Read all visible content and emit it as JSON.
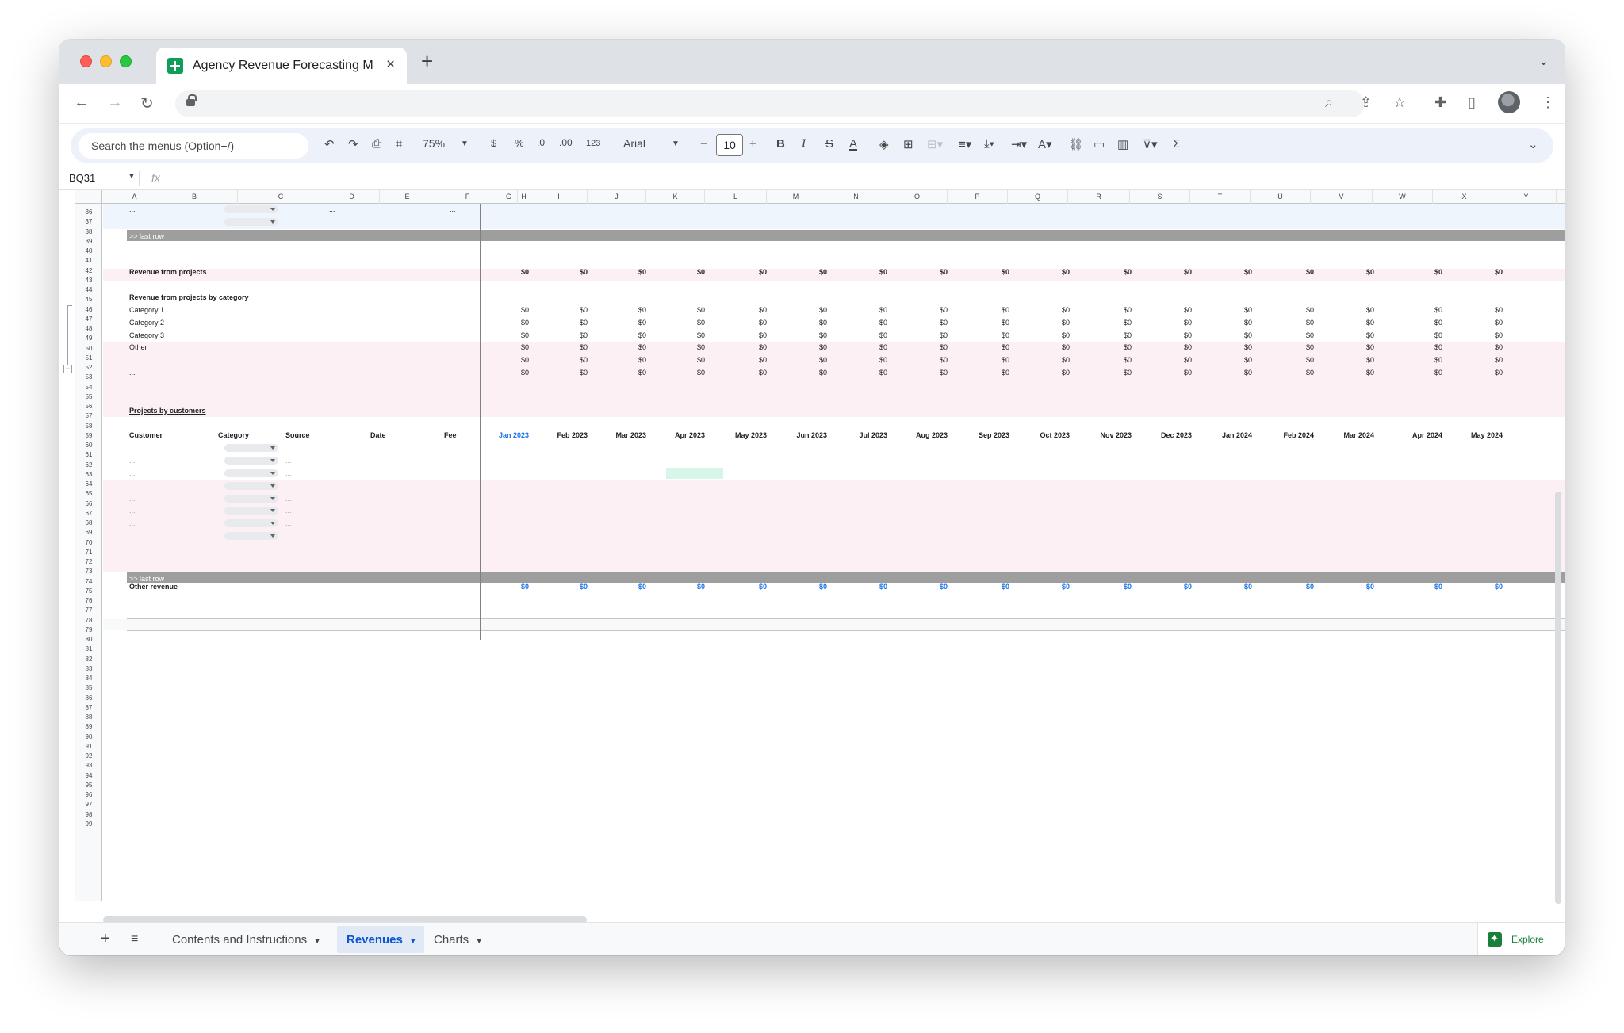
{
  "browser": {
    "tab_title": "Agency Revenue Forecasting M",
    "tab_close": "×",
    "new_tab": "+"
  },
  "toolbar": {
    "menu_search_placeholder": "Search the menus (Option+/)",
    "zoom": "75%",
    "currency": "$",
    "percent": "%",
    "dec_decrease": ".0",
    "dec_increase": ".00",
    "number_format": "123",
    "font": "Arial",
    "font_size": "10",
    "minus": "−",
    "plus": "+",
    "bold": "B",
    "italic": "I",
    "strike": "S",
    "text_color": "A",
    "sum": "Σ"
  },
  "formula_bar": {
    "cell_ref": "BQ31",
    "fx": "fx"
  },
  "columns": [
    "A",
    "B",
    "C",
    "D",
    "E",
    "F",
    "G",
    "H",
    "I",
    "J",
    "K",
    "L",
    "M",
    "N",
    "O",
    "P",
    "Q",
    "R",
    "S",
    "T",
    "U",
    "V",
    "W",
    "X",
    "Y"
  ],
  "rows": [
    "36",
    "37",
    "38",
    "39",
    "40",
    "41",
    "42",
    "43",
    "44",
    "45",
    "46",
    "47",
    "48",
    "49",
    "50",
    "51",
    "52",
    "53",
    "54",
    "55",
    "56",
    "57",
    "58",
    "59",
    "60",
    "61",
    "62",
    "63",
    "64",
    "65",
    "66",
    "67",
    "68",
    "69",
    "70",
    "71",
    "72",
    "73",
    "74",
    "75",
    "76",
    "77",
    "78",
    "79",
    "80",
    "81",
    "82",
    "83",
    "84",
    "85",
    "86",
    "87",
    "88",
    "89",
    "90",
    "91",
    "92",
    "93",
    "94",
    "95",
    "96",
    "97",
    "98",
    "99"
  ],
  "sheet": {
    "ellipsis": "...",
    "last_row": ">> last row",
    "zero": "$0",
    "revenue_from_projects": "Revenue from projects",
    "revenue_by_category_title": "Revenue from projects by category",
    "categories": [
      "Category 1",
      "Category 2",
      "Category 3",
      "Other",
      "...",
      "..."
    ],
    "projects_by_customers": "Projects by customers",
    "headers": {
      "customer": "Customer",
      "category": "Category",
      "source": "Source",
      "date": "Date",
      "fee": "Fee"
    },
    "months": [
      "Jan 2023",
      "Feb 2023",
      "Mar 2023",
      "Apr 2023",
      "May 2023",
      "Jun 2023",
      "Jul 2023",
      "Aug 2023",
      "Sep 2023",
      "Oct 2023",
      "Nov 2023",
      "Dec 2023",
      "Jan 2024",
      "Feb 2024",
      "Mar 2024",
      "Apr 2024",
      "May 2024"
    ],
    "other_revenue": "Other revenue"
  },
  "sheet_tabs": [
    {
      "label": "Contents and Instructions",
      "active": false
    },
    {
      "label": "Revenues",
      "active": true
    },
    {
      "label": "Charts",
      "active": false
    }
  ],
  "explore_label": "Explore",
  "colors": {
    "pink_band": "#fdf0f4",
    "blue_band": "#eef5fc",
    "gray_bar": "#9e9e9e",
    "link_blue": "#1a73e8",
    "highlight": "#d7f5e9"
  }
}
